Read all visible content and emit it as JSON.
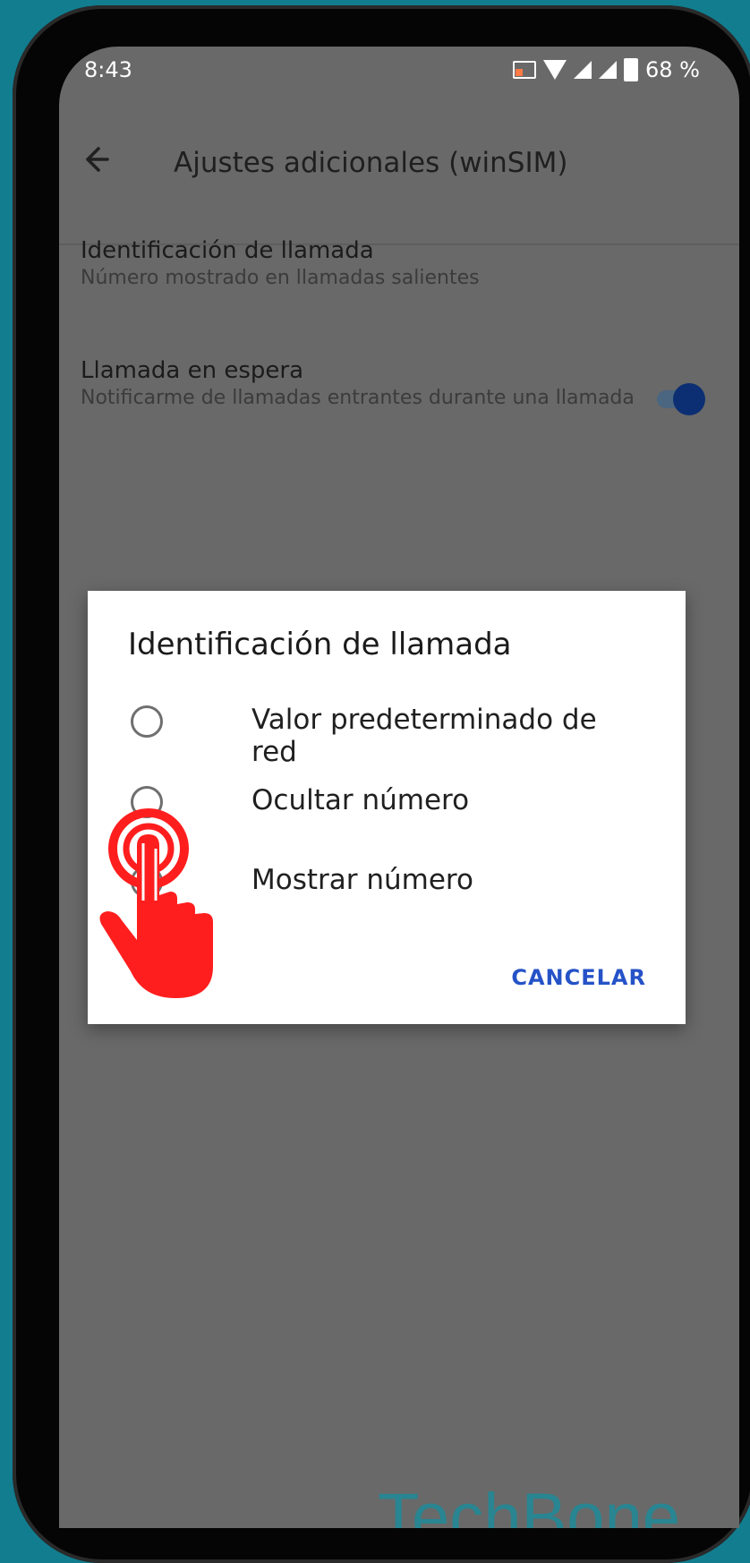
{
  "status": {
    "time": "8:43",
    "battery": "68 %"
  },
  "appbar": {
    "title": "Ajustes adicionales (winSIM)"
  },
  "settings": [
    {
      "title": "Identificación de llamada",
      "subtitle": "Número mostrado en llamadas salientes"
    },
    {
      "title": "Llamada en espera",
      "subtitle": "Notificarme de llamadas entrantes durante una llamada",
      "toggle_on": true
    }
  ],
  "dialog": {
    "title": "Identificación de llamada",
    "options": [
      "Valor predeterminado de red",
      "Ocultar número",
      "Mostrar número"
    ],
    "cancel": "CANCELAR"
  },
  "watermark": "TechBone",
  "colors": {
    "background": "#127d8f",
    "screen_overlay": "#696969",
    "accent": "#2552c7",
    "hand": "#ff1e1e"
  }
}
